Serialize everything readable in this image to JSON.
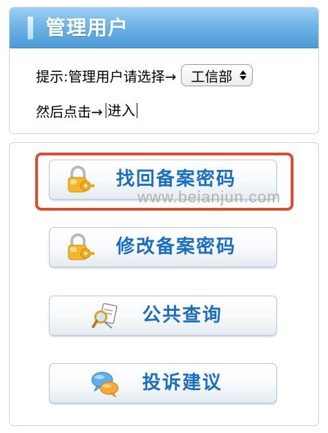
{
  "header": {
    "title": "管理用户"
  },
  "prompt": {
    "line1_text": "提示:管理用户请选择→",
    "select_value": "工信部",
    "line2_text": "然后点击→",
    "enter_link": "进入"
  },
  "buttons": [
    {
      "label": "找回备案密码",
      "icon": "lock-key-icon"
    },
    {
      "label": "修改备案密码",
      "icon": "lock-key-icon"
    },
    {
      "label": "公共查询",
      "icon": "magnifier-document-icon"
    },
    {
      "label": "投诉建议",
      "icon": "chat-bubbles-icon"
    }
  ],
  "watermark": "www.beianjun.com",
  "colors": {
    "header_blue": "#6fb4e6",
    "button_text": "#1a6fc4",
    "highlight_border": "#e8462a"
  }
}
